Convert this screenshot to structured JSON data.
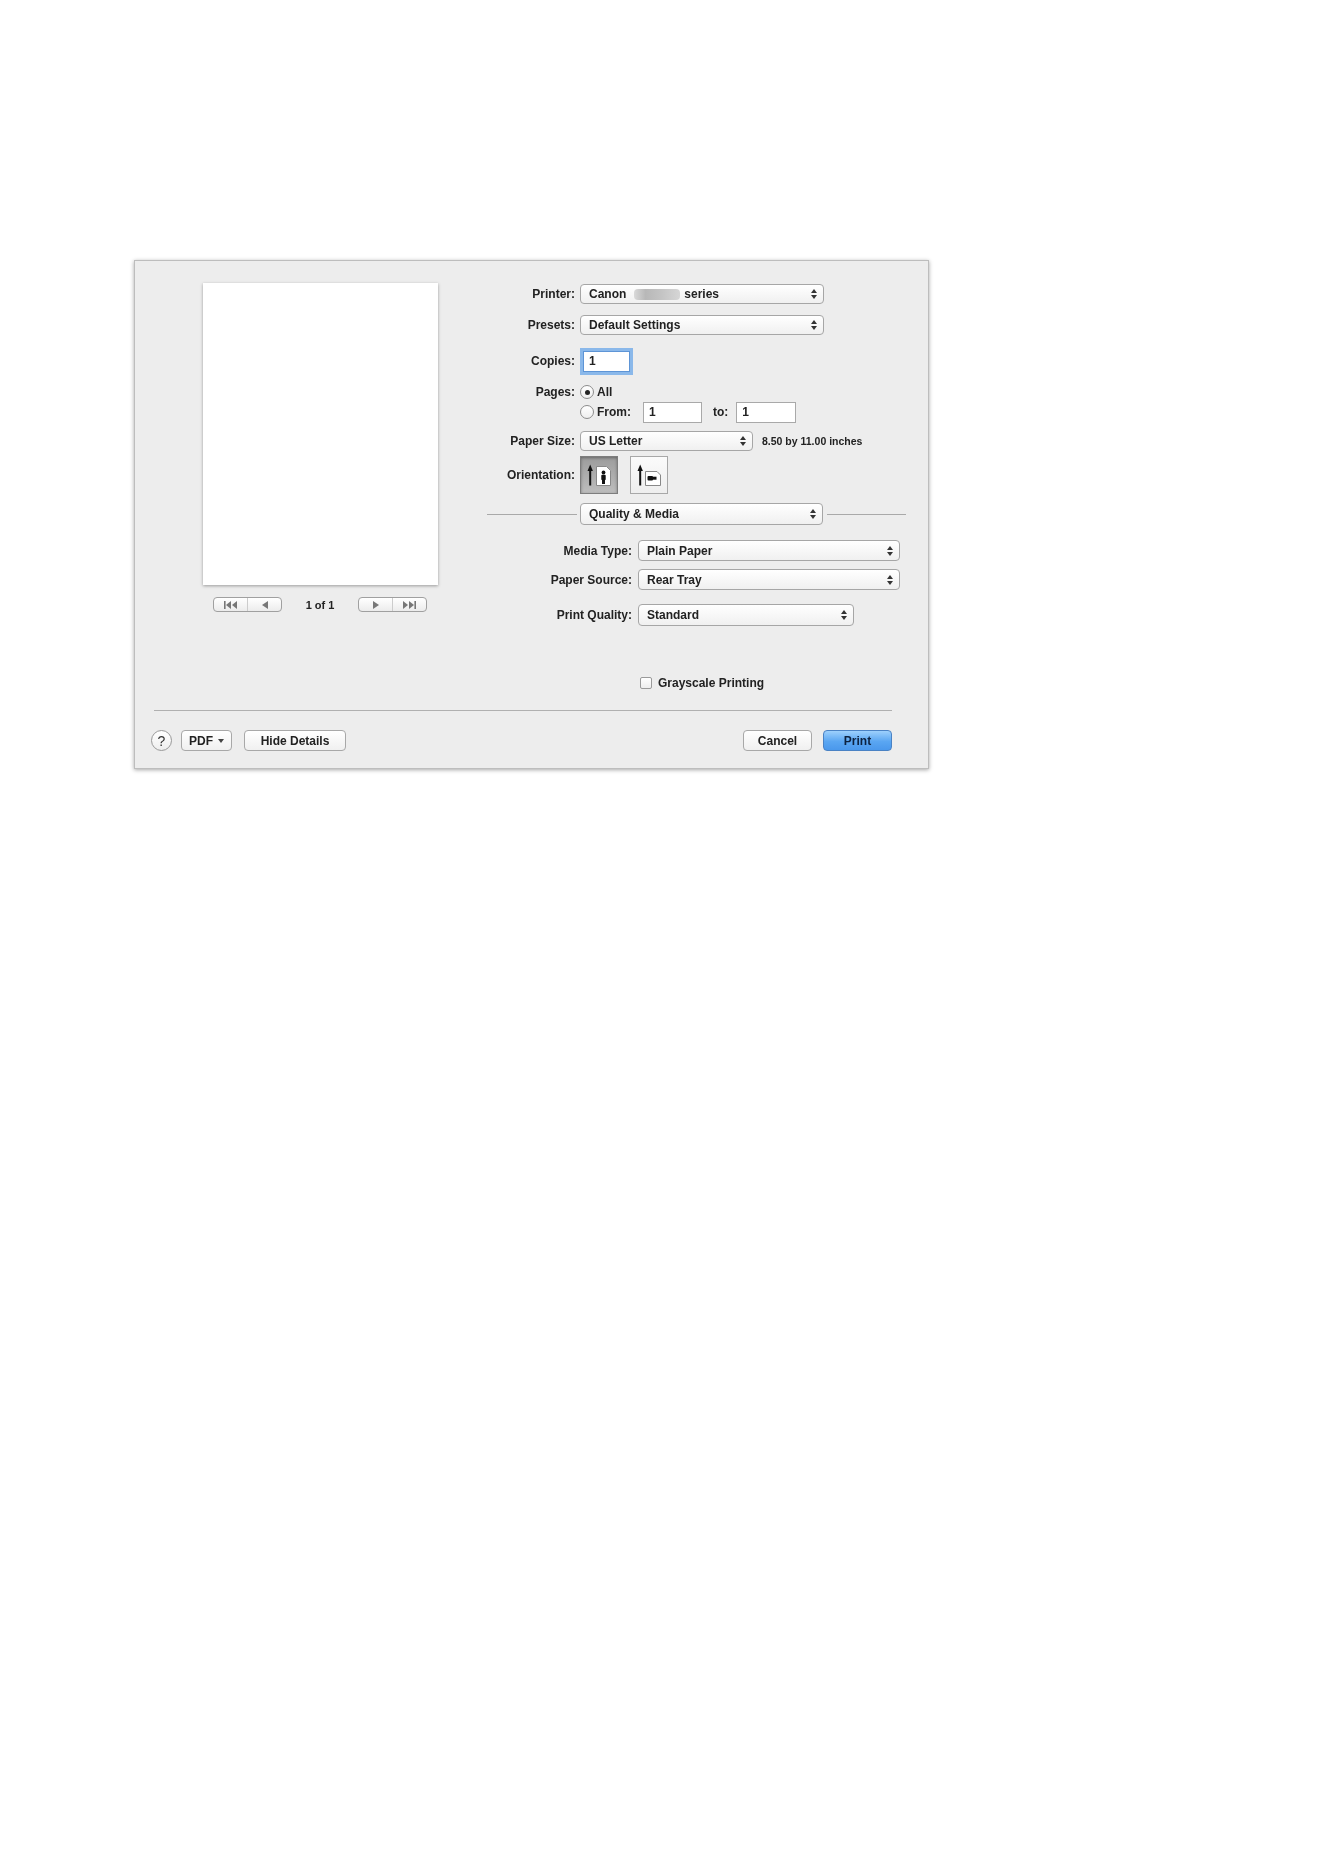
{
  "preview": {
    "page_count": "1 of 1"
  },
  "settings": {
    "printer": {
      "label": "Printer:",
      "value_start": "Canon",
      "redacted": true,
      "value_end": "series"
    },
    "presets": {
      "label": "Presets:",
      "value": "Default Settings"
    },
    "copies": {
      "label": "Copies:",
      "value": "1",
      "focused": true
    },
    "pages": {
      "label": "Pages:",
      "options": [
        {
          "kind": "all",
          "label": "All",
          "selected": true
        },
        {
          "kind": "range",
          "label": "From:",
          "selected": false,
          "from": "1",
          "to_label": "to:",
          "to": "1"
        }
      ]
    },
    "paper_size": {
      "label": "Paper Size:",
      "value": "US Letter",
      "dimensions": "8.50 by 11.00 inches"
    },
    "orientation": {
      "label": "Orientation:",
      "options": [
        {
          "kind": "portrait",
          "selected": true
        },
        {
          "kind": "landscape",
          "selected": false
        }
      ]
    }
  },
  "panel_menu": {
    "value": "Quality & Media"
  },
  "quality_media": {
    "media_type": {
      "label": "Media Type:",
      "value": "Plain Paper"
    },
    "paper_source": {
      "label": "Paper Source:",
      "value": "Rear Tray"
    },
    "print_quality": {
      "label": "Print Quality:",
      "value": "Standard"
    },
    "grayscale": {
      "label": "Grayscale Printing",
      "checked": false
    }
  },
  "footer": {
    "help": "?",
    "pdf": "PDF",
    "hide_details": "Hide Details",
    "cancel": "Cancel",
    "print": {
      "label": "Print",
      "default": true
    }
  }
}
